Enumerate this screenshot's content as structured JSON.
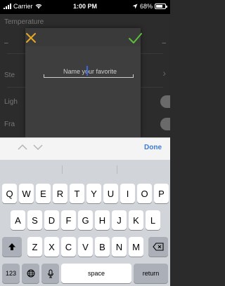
{
  "status_bar": {
    "carrier": "Carrier",
    "time": "1:00 PM",
    "battery": "68%"
  },
  "background": {
    "title": "Temperature",
    "row_label_1": "Ste",
    "row_label_2": "Ligh",
    "row_label_3": "Fra"
  },
  "dialog": {
    "placeholder": "Name your favorite"
  },
  "toolbar": {
    "done_label": "Done"
  },
  "keyboard": {
    "row1": [
      "Q",
      "W",
      "E",
      "R",
      "T",
      "Y",
      "U",
      "I",
      "O",
      "P"
    ],
    "row2": [
      "A",
      "S",
      "D",
      "F",
      "G",
      "H",
      "J",
      "K",
      "L"
    ],
    "row3": [
      "Z",
      "X",
      "C",
      "V",
      "B",
      "N",
      "M"
    ],
    "numbers_label": "123",
    "space_label": "space",
    "return_label": "return"
  },
  "colors": {
    "accent_blue": "#3a7bd5",
    "ok_green": "#5cbf3a",
    "cancel_orange": "#e6a824"
  }
}
